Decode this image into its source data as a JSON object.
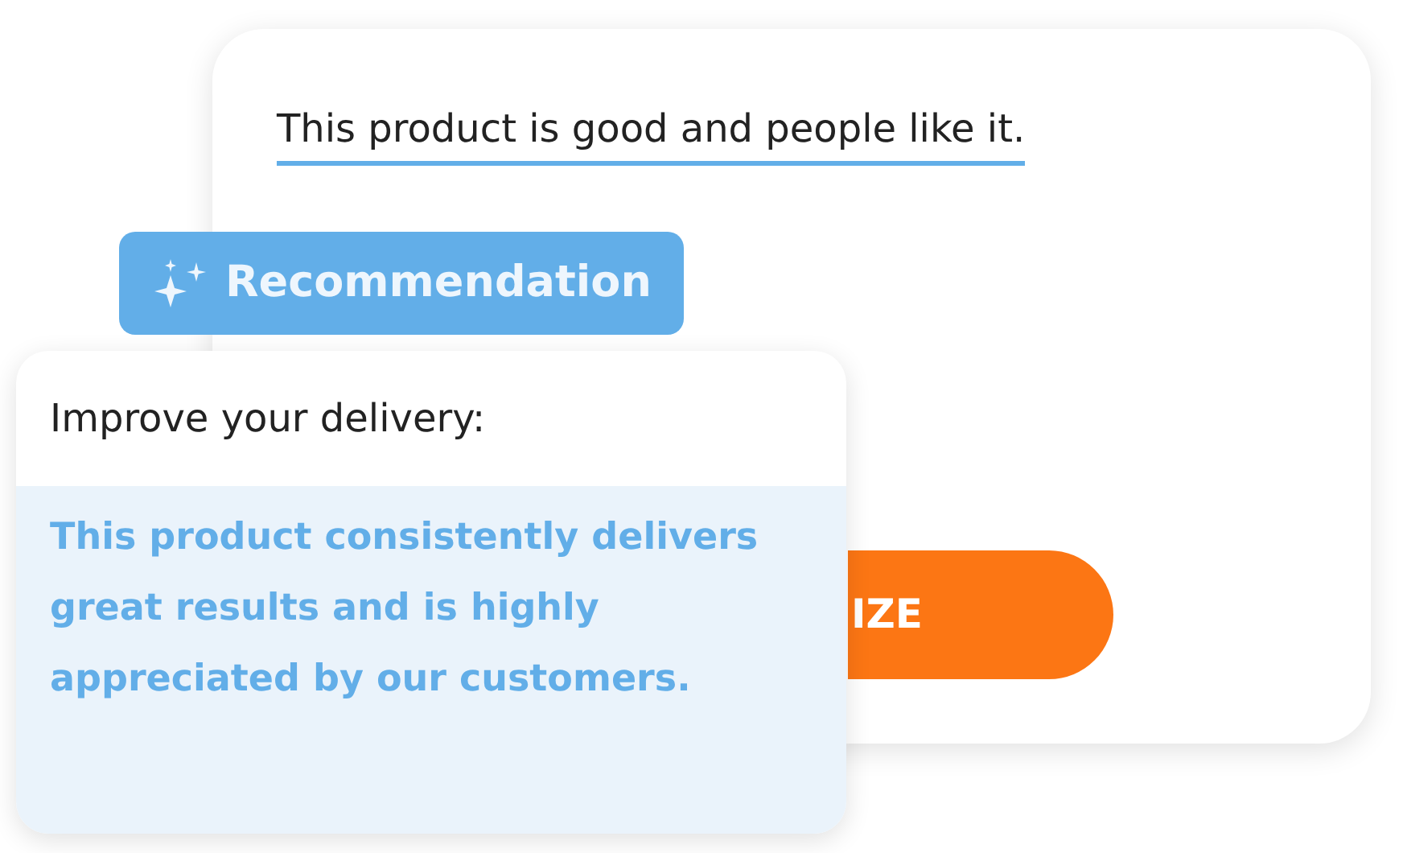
{
  "back_card": {
    "sentence": "This product is good and people like it.",
    "button": "IZE"
  },
  "badge": {
    "label": "Recommendation"
  },
  "front_card": {
    "heading": "Improve your delivery:",
    "suggestion": "This product consistently delivers great results and is highly appreciated by our customers."
  }
}
